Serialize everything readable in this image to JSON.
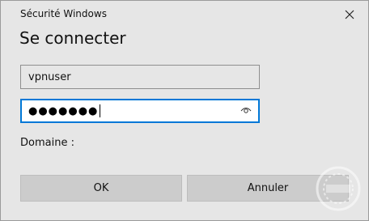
{
  "window": {
    "title": "Sécurité Windows"
  },
  "dialog": {
    "heading": "Se connecter",
    "username_value": "vpnuser",
    "password_masked": "●●●●●●●",
    "domain_label": "Domaine :"
  },
  "buttons": {
    "ok": "OK",
    "cancel": "Annuler"
  },
  "colors": {
    "focus_border": "#0078d7",
    "background": "#e6e6e6",
    "button_bg": "#cccccc"
  },
  "icons": {
    "close": "close-icon",
    "reveal": "eye-icon",
    "watermark": "watermark-logo"
  }
}
